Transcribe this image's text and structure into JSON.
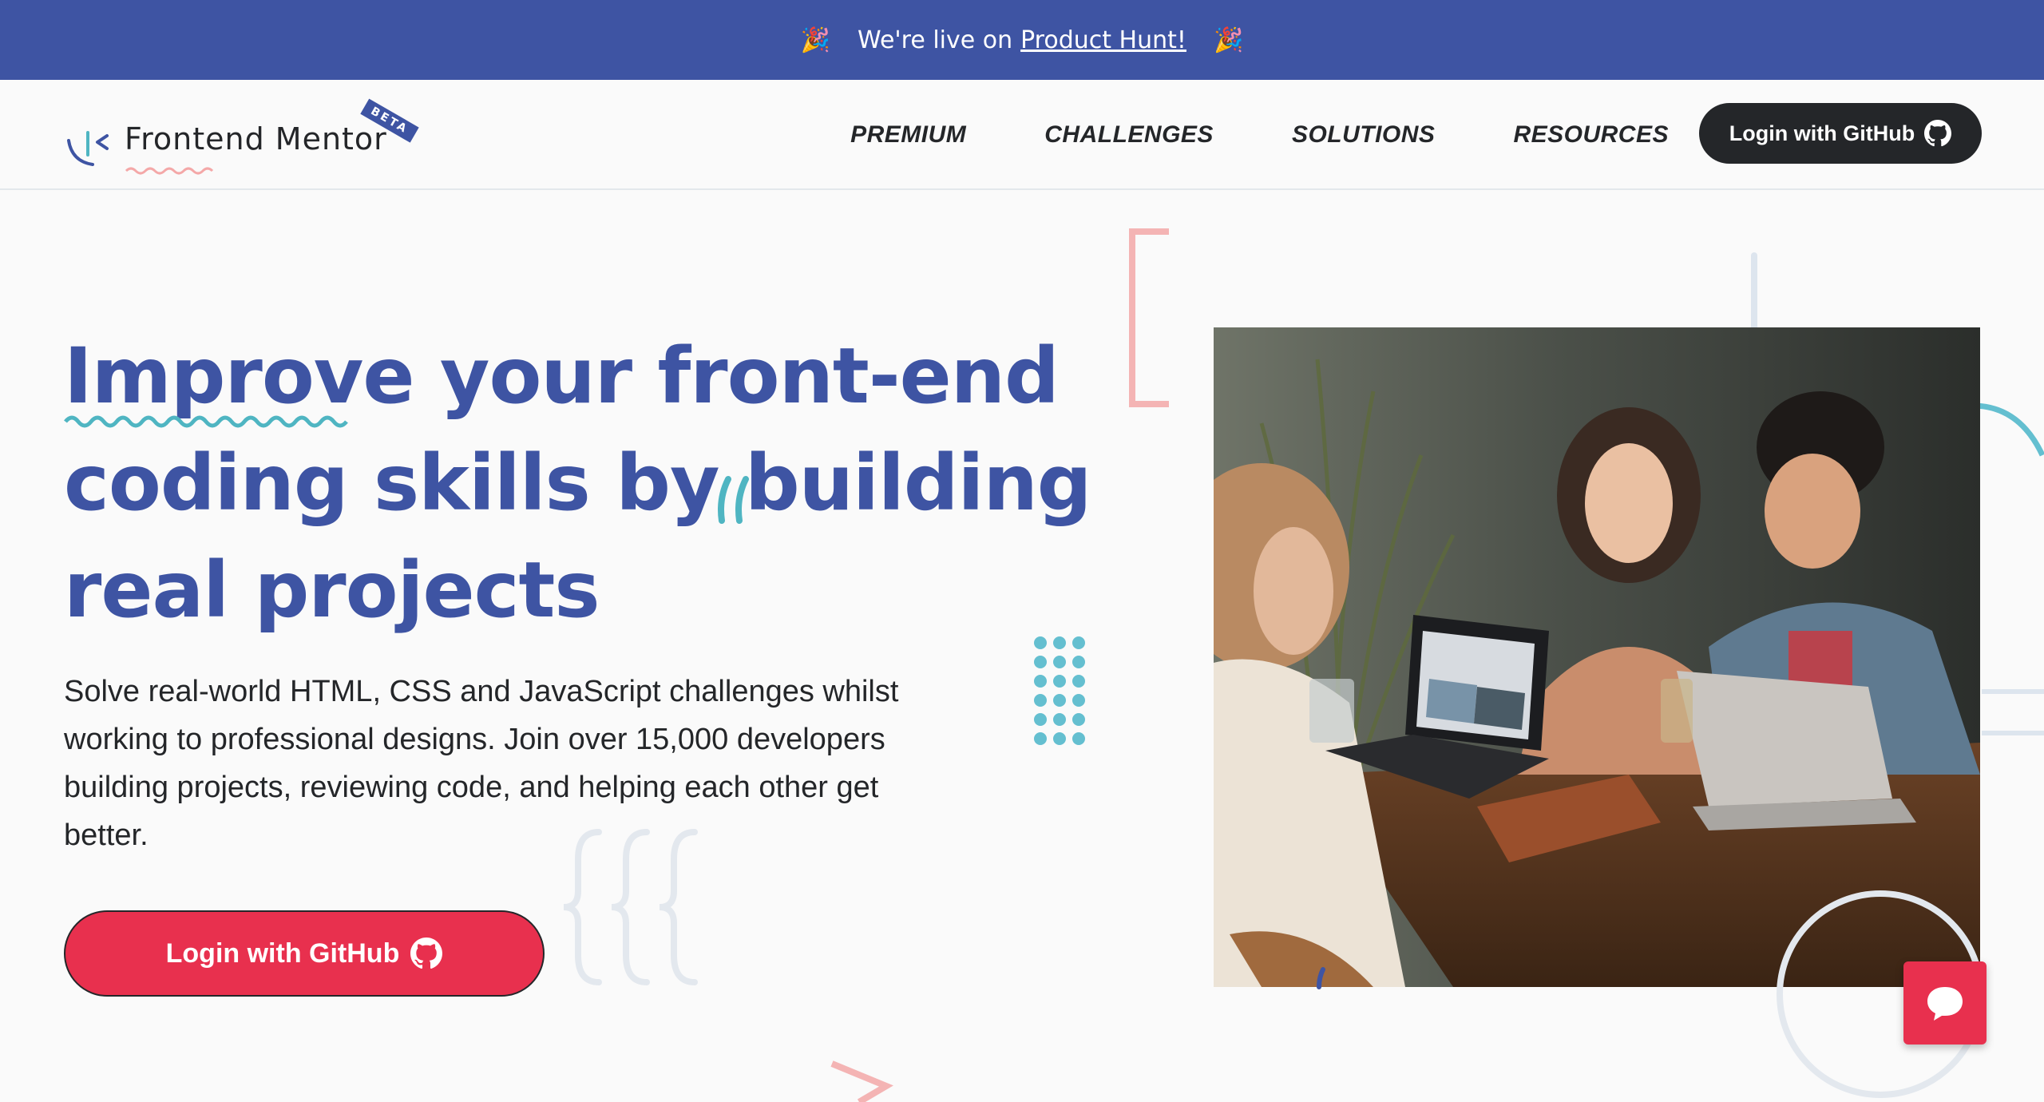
{
  "announcement": {
    "prefix": "We're live on",
    "link": "Product Hunt!",
    "emoji": "🎉"
  },
  "header": {
    "logo_text": "Frontend Mentor",
    "badge": "BETA",
    "nav": [
      "PREMIUM",
      "CHALLENGES",
      "SOLUTIONS",
      "RESOURCES"
    ],
    "login_label": "Login with GitHub"
  },
  "hero": {
    "title_lines": [
      "Improve your front-end",
      "coding skills by building",
      "real projects"
    ],
    "description": "Solve real-world HTML, CSS and JavaScript challenges whilst working to professional designs. Join over 15,000 developers building projects, reviewing code, and helping each other get better.",
    "login_label": "Login with GitHub"
  },
  "colors": {
    "brand_blue": "#3e54a3",
    "accent_red": "#e8304e",
    "dark": "#242629",
    "teal": "#4fb5c2",
    "pink": "#f4a8a8"
  },
  "icons": {
    "github": "github-icon",
    "chat": "chat-icon"
  }
}
